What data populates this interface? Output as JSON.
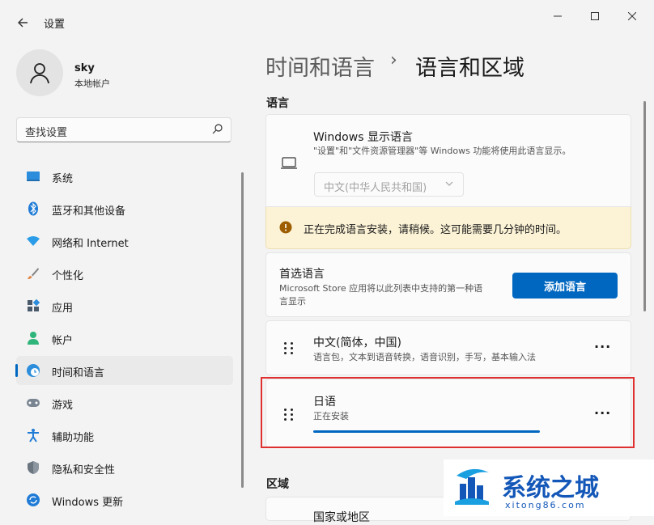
{
  "window": {
    "title": "设置",
    "controls": [
      "minimize-icon",
      "maximize-icon",
      "close-icon"
    ]
  },
  "profile": {
    "name": "sky",
    "account": "本地帐户"
  },
  "search": {
    "placeholder": "查找设置"
  },
  "nav": {
    "items": [
      {
        "label": "系统",
        "icon": "system-icon",
        "selected": false
      },
      {
        "label": "蓝牙和其他设备",
        "icon": "bluetooth-icon",
        "selected": false
      },
      {
        "label": "网络和 Internet",
        "icon": "network-icon",
        "selected": false
      },
      {
        "label": "个性化",
        "icon": "brush-icon",
        "selected": false
      },
      {
        "label": "应用",
        "icon": "apps-icon",
        "selected": false
      },
      {
        "label": "帐户",
        "icon": "account-icon",
        "selected": false
      },
      {
        "label": "时间和语言",
        "icon": "time-language-icon",
        "selected": true
      },
      {
        "label": "游戏",
        "icon": "gaming-icon",
        "selected": false
      },
      {
        "label": "辅助功能",
        "icon": "accessibility-icon",
        "selected": false
      },
      {
        "label": "隐私和安全性",
        "icon": "shield-icon",
        "selected": false
      },
      {
        "label": "Windows 更新",
        "icon": "update-icon",
        "selected": false
      }
    ]
  },
  "breadcrumb": {
    "parent": "时间和语言",
    "separator": "›",
    "current": "语言和区域"
  },
  "sections": {
    "language": "语言",
    "region": "区域"
  },
  "display_language": {
    "title": "Windows 显示语言",
    "description": "\"设置\"和\"文件资源管理器\"等 Windows 功能将使用此语言显示。",
    "selected": "中文(中华人民共和国)"
  },
  "warning": {
    "text": "正在完成语言安装，请稍候。这可能需要几分钟的时间。"
  },
  "preferred": {
    "title": "首选语言",
    "description_line1": "Microsoft Store 应用将以此列表中支持的第一种语",
    "description_line2": "言显示",
    "add_button": "添加语言"
  },
  "languages": [
    {
      "name": "中文(简体，中国)",
      "features": "语言包，文本到语音转换，语音识别，手写，基本输入法",
      "more": "···"
    },
    {
      "name": "日语",
      "status": "正在安装",
      "more": "···"
    }
  ],
  "region_card": {
    "title": "国家或地区"
  },
  "watermark": {
    "title": "系统之城",
    "url": "xitong86.com"
  },
  "colors": {
    "accent": "#0067c0",
    "warning_bg": "#fcf3d6",
    "highlight": "#e03131"
  }
}
